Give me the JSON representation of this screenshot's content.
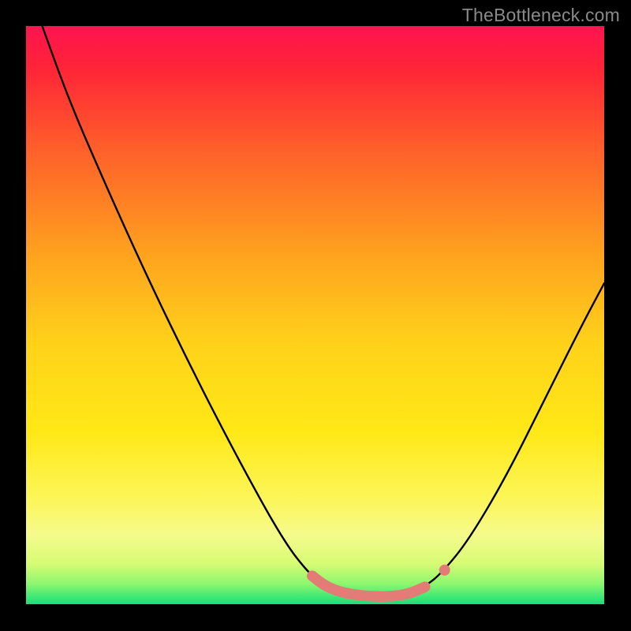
{
  "watermark": "TheBottleneck.com",
  "chart_data": {
    "type": "line",
    "title": "",
    "xlabel": "",
    "ylabel": "",
    "xlim": [
      0,
      1
    ],
    "ylim": [
      0,
      1
    ],
    "gradient_stops": [
      {
        "offset": 0.0,
        "color": "#ff1450"
      },
      {
        "offset": 0.07,
        "color": "#ff2338"
      },
      {
        "offset": 0.2,
        "color": "#ff5a2b"
      },
      {
        "offset": 0.4,
        "color": "#ffa41e"
      },
      {
        "offset": 0.55,
        "color": "#ffd21a"
      },
      {
        "offset": 0.7,
        "color": "#ffe816"
      },
      {
        "offset": 0.82,
        "color": "#fcf65a"
      },
      {
        "offset": 0.88,
        "color": "#f5fb8c"
      },
      {
        "offset": 0.93,
        "color": "#d7fb74"
      },
      {
        "offset": 0.965,
        "color": "#8cf66e"
      },
      {
        "offset": 1.0,
        "color": "#16e07a"
      }
    ],
    "series": [
      {
        "name": "black-curve",
        "type": "line",
        "points": [
          {
            "x": 0.028,
            "y": 1.0
          },
          {
            "x": 0.075,
            "y": 0.87
          },
          {
            "x": 0.14,
            "y": 0.72
          },
          {
            "x": 0.21,
            "y": 0.565
          },
          {
            "x": 0.29,
            "y": 0.4
          },
          {
            "x": 0.37,
            "y": 0.245
          },
          {
            "x": 0.445,
            "y": 0.11
          },
          {
            "x": 0.49,
            "y": 0.052
          },
          {
            "x": 0.52,
            "y": 0.03
          },
          {
            "x": 0.555,
            "y": 0.018
          },
          {
            "x": 0.605,
            "y": 0.013
          },
          {
            "x": 0.65,
            "y": 0.015
          },
          {
            "x": 0.69,
            "y": 0.03
          },
          {
            "x": 0.72,
            "y": 0.055
          },
          {
            "x": 0.765,
            "y": 0.11
          },
          {
            "x": 0.83,
            "y": 0.22
          },
          {
            "x": 0.9,
            "y": 0.36
          },
          {
            "x": 0.96,
            "y": 0.48
          },
          {
            "x": 1.0,
            "y": 0.555
          }
        ]
      },
      {
        "name": "pink-highlight",
        "type": "line",
        "points": [
          {
            "x": 0.495,
            "y": 0.049
          },
          {
            "x": 0.515,
            "y": 0.033
          },
          {
            "x": 0.54,
            "y": 0.022
          },
          {
            "x": 0.57,
            "y": 0.016
          },
          {
            "x": 0.605,
            "y": 0.013
          },
          {
            "x": 0.64,
            "y": 0.014
          },
          {
            "x": 0.665,
            "y": 0.019
          },
          {
            "x": 0.69,
            "y": 0.03
          }
        ]
      },
      {
        "name": "pink-dot",
        "type": "scatter",
        "points": [
          {
            "x": 0.724,
            "y": 0.059
          }
        ]
      }
    ]
  }
}
